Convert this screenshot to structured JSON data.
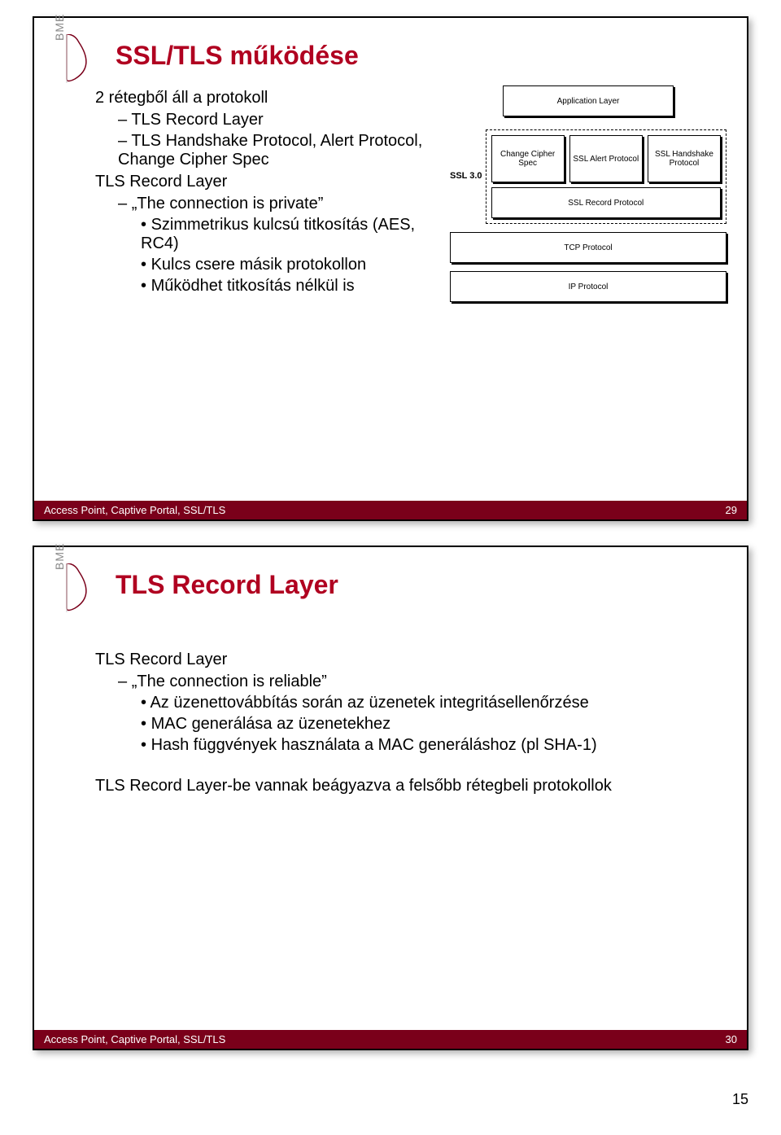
{
  "logo": {
    "text": "BME"
  },
  "slide1": {
    "title": "SSL/TLS működése",
    "l0a": "2 rétegből áll a protokoll",
    "l1a": "TLS Record Layer",
    "l1b": "TLS Handshake Protocol, Alert Protocol, Change Cipher Spec",
    "l0b": "TLS Record Layer",
    "l1c_quote": "The connection is private",
    "l2a": "Szimmetrikus kulcsú titkosítás (AES, RC4)",
    "l2b": "Kulcs csere másik protokollon",
    "l2c": "Működhet titkosítás nélkül is",
    "footer_left": "Access Point, Captive Portal, SSL/TLS",
    "footer_right": "29",
    "diagram": {
      "ssl30": "SSL 3.0",
      "app": "Application Layer",
      "ccs": "Change Cipher Spec",
      "alert": "SSL Alert Protocol",
      "hs": "SSL Handshake Protocol",
      "record": "SSL Record Protocol",
      "tcp": "TCP Protocol",
      "ip": "IP Protocol"
    }
  },
  "slide2": {
    "title": "TLS Record Layer",
    "l0a": "TLS Record Layer",
    "l1a_quote": "The connection is reliable",
    "l2a": "Az üzenettovábbítás során az üzenetek integritásellenőrzése",
    "l2b": "MAC generálása az üzenetekhez",
    "l2c": "Hash függvények használata a MAC generáláshoz (pl SHA-1)",
    "l0b": "TLS Record Layer-be vannak beágyazva a felsőbb rétegbeli protokollok",
    "footer_left": "Access Point, Captive Portal, SSL/TLS",
    "footer_right": "30"
  },
  "page_number": "15"
}
